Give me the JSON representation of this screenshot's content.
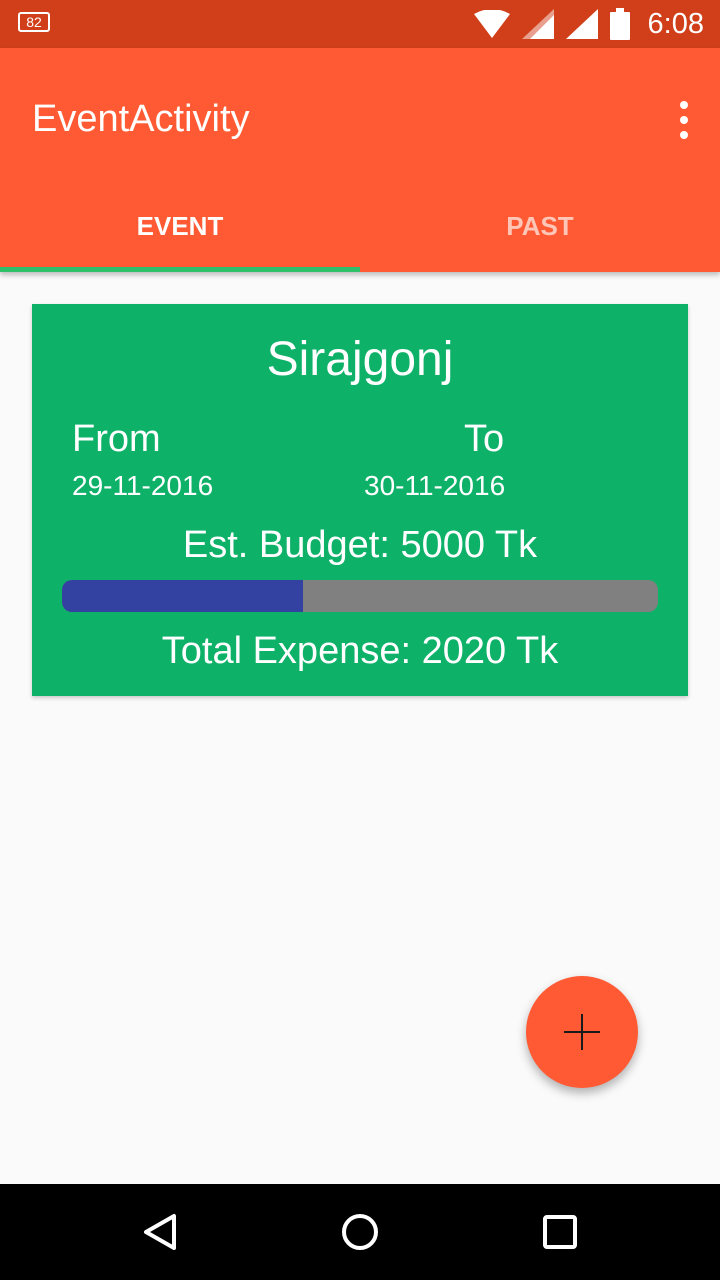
{
  "status_bar": {
    "notification_badge": "82",
    "notification_icon": "notification-count-icon",
    "wifi_icon": "wifi-icon",
    "signal_icon": "cell-signal-icon",
    "battery_icon": "battery-icon",
    "time": "6:08"
  },
  "app_bar": {
    "title": "EventActivity",
    "overflow_icon": "more-vert-icon",
    "color": "#ff5a33"
  },
  "tabs": [
    {
      "label": "EVENT",
      "selected": true
    },
    {
      "label": "PAST",
      "selected": false
    }
  ],
  "event_card": {
    "name": "Sirajgonj",
    "from_label": "From",
    "to_label": "To",
    "from_date": "29-11-2016",
    "to_date": "30-11-2016",
    "budget_text": "Est. Budget: 5000 Tk",
    "expense_fraction": 0.404,
    "expense_text": "Total Expense: 2020 Tk",
    "color": "#0db168",
    "progress_color": "#3342a0"
  },
  "fab": {
    "icon": "add-icon"
  },
  "nav_bar": {
    "back_icon": "back-icon",
    "home_icon": "home-icon",
    "recents_icon": "recents-icon"
  }
}
